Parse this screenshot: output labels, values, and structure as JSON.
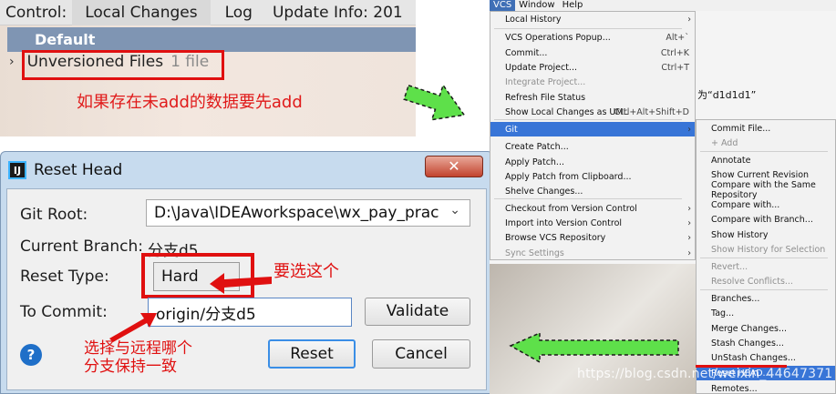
{
  "top_panel": {
    "tabs": [
      "Control:",
      "Local Changes",
      "Log",
      "Update Info: 201"
    ],
    "changelist": "Default",
    "unversioned_label": "Unversioned Files",
    "unversioned_count": "1 file",
    "note": "如果存在未add的数据要先add"
  },
  "dialog": {
    "title": "Reset Head",
    "close": "✕",
    "git_root_label": "Git Root:",
    "git_root_value": "D:\\Java\\IDEAworkspace\\wx_pay_prac",
    "current_branch_label": "Current Branch:",
    "current_branch_value": "分支d5",
    "reset_type_label": "Reset Type:",
    "reset_type_value": "Hard",
    "reset_note": "要选这个",
    "to_commit_label": "To Commit:",
    "to_commit_value": "origin/分支d5",
    "validate_label": "Validate",
    "commit_note_line1": "选择与远程哪个",
    "commit_note_line2": "分支保持一致",
    "help": "?",
    "reset_label": "Reset",
    "cancel_label": "Cancel"
  },
  "ide": {
    "menubar": [
      "VCS",
      "Window",
      "Help"
    ],
    "editor_text": "为“d1d1d1”",
    "vcs_menu": [
      {
        "label": "Local History",
        "shortcut": "",
        "arrow": true,
        "disabled": false
      },
      {
        "label": "VCS Operations Popup...",
        "shortcut": "Alt+`",
        "arrow": false,
        "disabled": false
      },
      {
        "label": "Commit...",
        "shortcut": "Ctrl+K",
        "arrow": false,
        "disabled": false
      },
      {
        "label": "Update Project...",
        "shortcut": "Ctrl+T",
        "arrow": false,
        "disabled": false
      },
      {
        "label": "Integrate Project...",
        "shortcut": "",
        "arrow": false,
        "disabled": true
      },
      {
        "label": "Refresh File Status",
        "shortcut": "",
        "arrow": false,
        "disabled": false
      },
      {
        "label": "Show Local Changes as UML",
        "shortcut": "Ctrl+Alt+Shift+D",
        "arrow": false,
        "disabled": false
      },
      {
        "label": "Git",
        "shortcut": "",
        "arrow": true,
        "disabled": false,
        "selected": true
      },
      {
        "label": "Create Patch...",
        "shortcut": "",
        "arrow": false,
        "disabled": false
      },
      {
        "label": "Apply Patch...",
        "shortcut": "",
        "arrow": false,
        "disabled": false
      },
      {
        "label": "Apply Patch from Clipboard...",
        "shortcut": "",
        "arrow": false,
        "disabled": false
      },
      {
        "label": "Shelve Changes...",
        "shortcut": "",
        "arrow": false,
        "disabled": false
      },
      {
        "label": "Checkout from Version Control",
        "shortcut": "",
        "arrow": true,
        "disabled": false
      },
      {
        "label": "Import into Version Control",
        "shortcut": "",
        "arrow": true,
        "disabled": false
      },
      {
        "label": "Browse VCS Repository",
        "shortcut": "",
        "arrow": true,
        "disabled": false
      },
      {
        "label": "Sync Settings",
        "shortcut": "",
        "arrow": true,
        "disabled": true
      }
    ],
    "git_menu": [
      {
        "label": "Commit File...",
        "disabled": false
      },
      {
        "label": "+ Add",
        "disabled": true
      },
      {
        "label": "Annotate",
        "disabled": false
      },
      {
        "label": "Show Current Revision",
        "disabled": false
      },
      {
        "label": "Compare with the Same Repository",
        "disabled": false
      },
      {
        "label": "Compare with...",
        "disabled": false
      },
      {
        "label": "Compare with Branch...",
        "disabled": false
      },
      {
        "label": "Show History",
        "disabled": false
      },
      {
        "label": "Show History for Selection",
        "disabled": true
      },
      {
        "label": "Revert...",
        "disabled": true
      },
      {
        "label": "Resolve Conflicts...",
        "disabled": true
      },
      {
        "label": "Branches...",
        "disabled": false
      },
      {
        "label": "Tag...",
        "disabled": false
      },
      {
        "label": "Merge Changes...",
        "disabled": false
      },
      {
        "label": "Stash Changes...",
        "disabled": false
      },
      {
        "label": "UnStash Changes...",
        "disabled": false
      },
      {
        "label": "Reset HEAD...",
        "disabled": false,
        "selected": true
      },
      {
        "label": "Remotes...",
        "disabled": false
      }
    ],
    "watermark": "https://blog.csdn.net/weixin_44647371"
  },
  "colors": {
    "accent_red": "#e01010",
    "arrow_green": "#5ee04a",
    "menu_selection": "#3875d7"
  }
}
